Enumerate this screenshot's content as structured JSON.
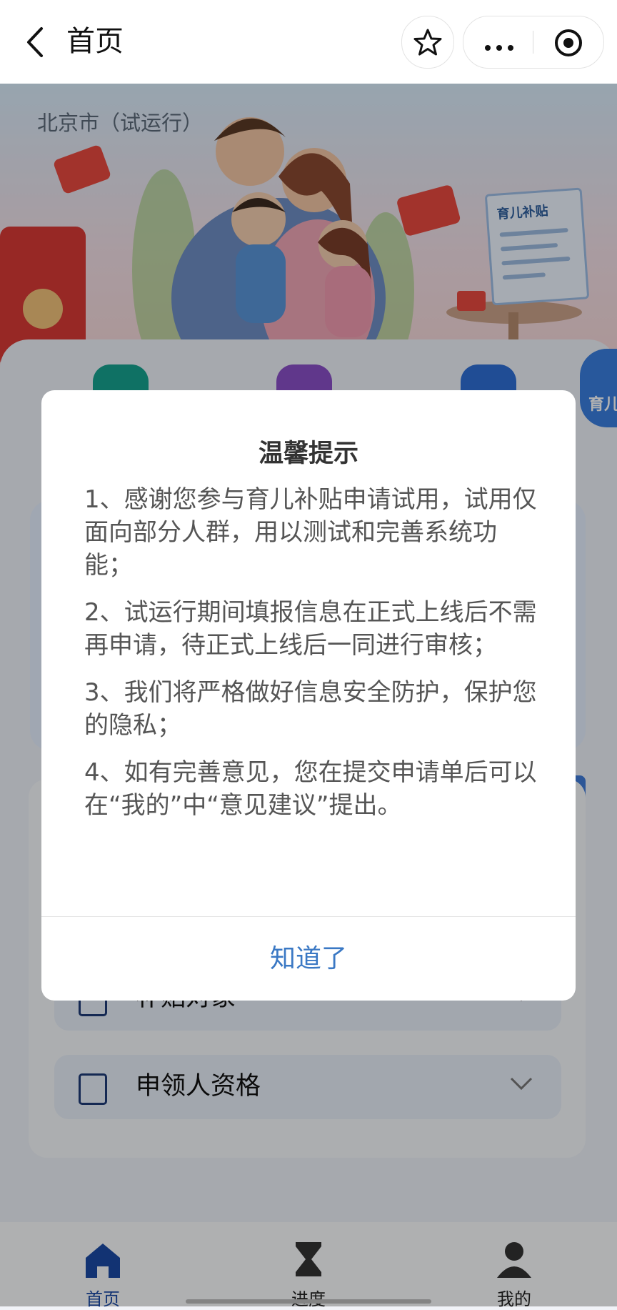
{
  "nav": {
    "title": "首页"
  },
  "hero": {
    "city_label": "北京市（试运行）",
    "doc_title": "育儿补贴"
  },
  "badge": {
    "text": "育儿"
  },
  "rows": [
    {
      "label": "补贴对象"
    },
    {
      "label": "申领人资格"
    }
  ],
  "tabs": [
    {
      "label": "首页",
      "icon": "home-icon",
      "active": true
    },
    {
      "label": "进度",
      "icon": "hourglass-icon",
      "active": false
    },
    {
      "label": "我的",
      "icon": "user-icon",
      "active": false
    }
  ],
  "dialog": {
    "title": "温馨提示",
    "items": [
      "1、感谢您参与育儿补贴申请试用，试用仅面向部分人群，用以测试和完善系统功能；",
      "2、试运行期间填报信息在正式上线后不需再申请，待正式上线后一同进行审核；",
      "3、我们将严格做好信息安全防护，保护您的隐私；",
      "4、如有完善意见，您在提交申请单后可以在“我的”中“意见建议”提出。"
    ],
    "confirm_label": "知道了"
  },
  "colors": {
    "accent": "#3a78c4",
    "primary_dark": "#1a4aa5",
    "mask": "rgba(0,0,0,0.30)"
  }
}
